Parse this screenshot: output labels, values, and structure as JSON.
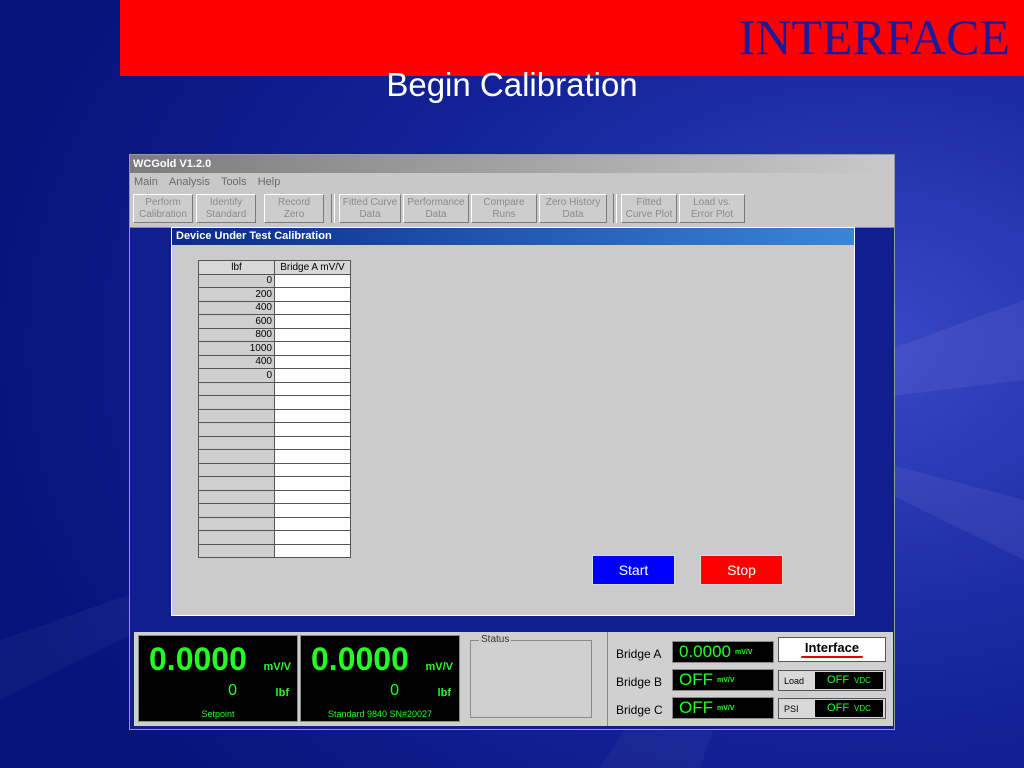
{
  "slide": {
    "brand": "INTERFACE",
    "title": "Begin Calibration"
  },
  "app": {
    "window_title": "WCGold  V1.2.0",
    "menu": [
      "Main",
      "Analysis",
      "Tools",
      "Help"
    ],
    "toolbar": [
      {
        "line1": "Perform",
        "line2": "Calibration"
      },
      {
        "line1": "Identify",
        "line2": "Standard"
      },
      {
        "line1": "Record",
        "line2": "Zero"
      },
      {
        "line1": "Fitted Curve",
        "line2": "Data"
      },
      {
        "line1": "Performance",
        "line2": "Data"
      },
      {
        "line1": "Compare",
        "line2": "Runs"
      },
      {
        "line1": "Zero History",
        "line2": "Data"
      },
      {
        "line1": "Fitted",
        "line2": "Curve Plot"
      },
      {
        "line1": "Load vs.",
        "line2": "Error Plot"
      }
    ]
  },
  "dialog": {
    "title": "Device Under Test  Calibration",
    "table": {
      "headers": [
        "lbf",
        "Bridge A mV/V"
      ],
      "lbf_values": [
        "0",
        "200",
        "400",
        "600",
        "800",
        "1000",
        "400",
        "0",
        "",
        "",
        "",
        "",
        "",
        "",
        "",
        "",
        "",
        "",
        "",
        "",
        ""
      ]
    },
    "start_label": "Start",
    "stop_label": "Stop"
  },
  "readouts": {
    "setpoint": {
      "value": "0.0000",
      "unit": "mV/V",
      "load": "0",
      "load_unit": "lbf",
      "caption": "Setpoint"
    },
    "standard": {
      "value": "0.0000",
      "unit": "mV/V",
      "load": "0",
      "load_unit": "lbf",
      "caption": "Standard 9840 SN#20027"
    },
    "status_label": "Status"
  },
  "bridges": {
    "a": {
      "label": "Bridge A",
      "value": "0.0000",
      "unit": "mV/V"
    },
    "b": {
      "label": "Bridge B",
      "value": "OFF",
      "unit": "mV/V"
    },
    "c": {
      "label": "Bridge C",
      "value": "OFF",
      "unit": "mV/V"
    },
    "brand": "Interface",
    "load": {
      "label": "Load",
      "value": "OFF",
      "unit": "VDC"
    },
    "psi": {
      "label": "PSI",
      "value": "OFF",
      "unit": "VDC"
    }
  },
  "colors": {
    "background": "#0a1a8c",
    "brand_bar": "#ff0000",
    "readout_green": "#22ff22",
    "start_button": "#0000ff",
    "stop_button": "#ff0000"
  }
}
